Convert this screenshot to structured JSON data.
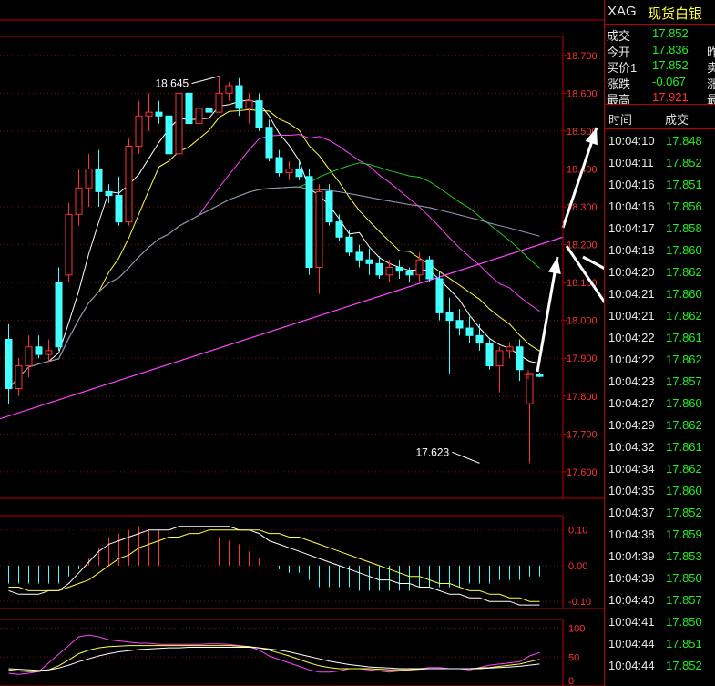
{
  "symbol": {
    "code": "XAG",
    "name": "现货白银",
    "code_color": "#e8e8e8",
    "name_color": "#ffff33"
  },
  "quote": [
    {
      "label": "成交",
      "value": "17.852",
      "color": "#22ee22",
      "extra": ""
    },
    {
      "label": "今开",
      "value": "17.836",
      "color": "#22ee22",
      "extra": "昨"
    },
    {
      "label": "买价1",
      "value": "17.852",
      "color": "#22ee22",
      "extra": "卖"
    },
    {
      "label": "涨跌",
      "value": "-0.067",
      "color": "#22ee22",
      "extra": "涨"
    },
    {
      "label": "最高",
      "value": "17.921",
      "color": "#ff3333",
      "extra": "最"
    }
  ],
  "ticks_header": {
    "time": "时间",
    "price": "成交"
  },
  "ticks": [
    {
      "time": "10:04:10",
      "price": "17.848"
    },
    {
      "time": "10:04:11",
      "price": "17.852"
    },
    {
      "time": "10:04:16",
      "price": "17.851"
    },
    {
      "time": "10:04:16",
      "price": "17.856"
    },
    {
      "time": "10:04:17",
      "price": "17.858"
    },
    {
      "time": "10:04:18",
      "price": "17.860"
    },
    {
      "time": "10:04:20",
      "price": "17.862"
    },
    {
      "time": "10:04:21",
      "price": "17.860"
    },
    {
      "time": "10:04:21",
      "price": "17.862"
    },
    {
      "time": "10:04:22",
      "price": "17.861"
    },
    {
      "time": "10:04:22",
      "price": "17.862"
    },
    {
      "time": "10:04:23",
      "price": "17.857"
    },
    {
      "time": "10:04:27",
      "price": "17.860"
    },
    {
      "time": "10:04:29",
      "price": "17.862"
    },
    {
      "time": "10:04:32",
      "price": "17.861"
    },
    {
      "time": "10:04:34",
      "price": "17.862"
    },
    {
      "time": "10:04:35",
      "price": "17.860"
    },
    {
      "time": "10:04:37",
      "price": "17.852"
    },
    {
      "time": "10:04:38",
      "price": "17.859"
    },
    {
      "time": "10:04:39",
      "price": "17.853"
    },
    {
      "time": "10:04:39",
      "price": "17.850"
    },
    {
      "time": "10:04:40",
      "price": "17.857"
    },
    {
      "time": "10:04:41",
      "price": "17.850"
    },
    {
      "time": "10:04:44",
      "price": "17.851"
    },
    {
      "time": "10:04:44",
      "price": "17.852"
    }
  ],
  "chart_data": [
    {
      "type": "candlestick",
      "title": "",
      "ylim": [
        17.53,
        18.75
      ],
      "yticks": [
        "18.700",
        "18.600",
        "18.500",
        "18.400",
        "18.300",
        "18.200",
        "18.100",
        "18.000",
        "17.900",
        "17.800",
        "17.700",
        "17.600"
      ],
      "annotations": [
        {
          "text": "18.645",
          "index": 21,
          "value": 18.645
        },
        {
          "text": "17.623",
          "index": 47,
          "value": 17.623
        }
      ],
      "ohlc": [
        [
          17.95,
          17.99,
          17.78,
          17.82
        ],
        [
          17.82,
          17.9,
          17.8,
          17.88
        ],
        [
          17.88,
          17.96,
          17.85,
          17.93
        ],
        [
          17.93,
          17.96,
          17.9,
          17.91
        ],
        [
          17.91,
          17.95,
          17.89,
          17.92
        ],
        [
          18.1,
          18.14,
          17.92,
          17.93
        ],
        [
          18.12,
          18.31,
          18.1,
          18.28
        ],
        [
          18.28,
          18.4,
          18.25,
          18.35
        ],
        [
          18.35,
          18.44,
          18.3,
          18.4
        ],
        [
          18.4,
          18.45,
          18.3,
          18.34
        ],
        [
          18.34,
          18.36,
          18.31,
          18.33
        ],
        [
          18.33,
          18.38,
          18.25,
          18.26
        ],
        [
          18.26,
          18.48,
          18.25,
          18.46
        ],
        [
          18.46,
          18.58,
          18.44,
          18.54
        ],
        [
          18.54,
          18.6,
          18.5,
          18.55
        ],
        [
          18.55,
          18.58,
          18.52,
          18.54
        ],
        [
          18.54,
          18.6,
          18.42,
          18.44
        ],
        [
          18.44,
          18.62,
          18.43,
          18.6
        ],
        [
          18.6,
          18.62,
          18.5,
          18.52
        ],
        [
          18.52,
          18.58,
          18.48,
          18.56
        ],
        [
          18.56,
          18.58,
          18.54,
          18.55
        ],
        [
          18.55,
          18.645,
          18.55,
          18.6
        ],
        [
          18.6,
          18.63,
          18.58,
          18.62
        ],
        [
          18.62,
          18.64,
          18.54,
          18.56
        ],
        [
          18.56,
          18.6,
          18.52,
          18.58
        ],
        [
          18.58,
          18.6,
          18.5,
          18.51
        ],
        [
          18.51,
          18.53,
          18.42,
          18.43
        ],
        [
          18.43,
          18.45,
          18.38,
          18.39
        ],
        [
          18.39,
          18.42,
          18.37,
          18.4
        ],
        [
          18.4,
          18.42,
          18.37,
          18.38
        ],
        [
          18.38,
          18.4,
          18.12,
          18.14
        ],
        [
          18.14,
          18.36,
          18.07,
          18.34
        ],
        [
          18.34,
          18.36,
          18.25,
          18.26
        ],
        [
          18.26,
          18.28,
          18.21,
          18.22
        ],
        [
          18.22,
          18.24,
          18.17,
          18.18
        ],
        [
          18.18,
          18.2,
          18.14,
          18.16
        ],
        [
          18.16,
          18.19,
          18.12,
          18.15
        ],
        [
          18.15,
          18.17,
          18.11,
          18.12
        ],
        [
          18.12,
          18.16,
          18.1,
          18.14
        ],
        [
          18.14,
          18.16,
          18.11,
          18.13
        ],
        [
          18.13,
          18.14,
          18.1,
          18.12
        ],
        [
          18.12,
          18.18,
          18.1,
          18.16
        ],
        [
          18.16,
          18.17,
          18.1,
          18.11
        ],
        [
          18.11,
          18.13,
          18.0,
          18.02
        ],
        [
          18.02,
          18.06,
          17.86,
          18.0
        ],
        [
          18.0,
          18.03,
          17.96,
          17.98
        ],
        [
          17.98,
          18.01,
          17.94,
          17.96
        ],
        [
          17.96,
          17.99,
          17.92,
          17.94
        ],
        [
          17.94,
          17.95,
          17.87,
          17.88
        ],
        [
          17.88,
          17.93,
          17.81,
          17.92
        ],
        [
          17.92,
          17.94,
          17.9,
          17.93
        ],
        [
          17.93,
          17.95,
          17.84,
          17.87
        ],
        [
          17.78,
          17.86,
          17.623,
          17.86
        ],
        [
          17.857,
          17.862,
          17.85,
          17.852
        ]
      ],
      "annotated_arrows": true
    },
    {
      "type": "bar",
      "title": "",
      "ylim": [
        -0.12,
        0.14
      ],
      "yticks": [
        "0.10",
        "0.00",
        "-0.10"
      ],
      "histogram": [
        -0.05,
        -0.05,
        -0.05,
        -0.05,
        -0.05,
        -0.05,
        -0.03,
        -0.01,
        0.02,
        0.05,
        0.08,
        0.09,
        0.1,
        0.11,
        0.1,
        0.1,
        0.1,
        0.1,
        0.1,
        0.09,
        0.09,
        0.08,
        0.07,
        0.06,
        0.04,
        0.02,
        0.0,
        -0.01,
        -0.02,
        -0.02,
        -0.04,
        -0.06,
        -0.06,
        -0.06,
        -0.06,
        -0.07,
        -0.07,
        -0.07,
        -0.07,
        -0.07,
        -0.07,
        -0.06,
        -0.06,
        -0.06,
        -0.06,
        -0.06,
        -0.05,
        -0.05,
        -0.05,
        -0.04,
        -0.04,
        -0.04,
        -0.03,
        -0.03
      ],
      "dif": [
        -0.07,
        -0.08,
        -0.08,
        -0.08,
        -0.07,
        -0.07,
        -0.05,
        -0.02,
        0.01,
        0.04,
        0.06,
        0.07,
        0.08,
        0.09,
        0.1,
        0.1,
        0.1,
        0.11,
        0.11,
        0.11,
        0.11,
        0.11,
        0.11,
        0.1,
        0.1,
        0.09,
        0.07,
        0.06,
        0.05,
        0.04,
        0.03,
        0.02,
        0.01,
        0.0,
        -0.01,
        -0.02,
        -0.03,
        -0.04,
        -0.04,
        -0.05,
        -0.05,
        -0.06,
        -0.06,
        -0.07,
        -0.08,
        -0.08,
        -0.09,
        -0.09,
        -0.1,
        -0.1,
        -0.1,
        -0.11,
        -0.11,
        -0.11
      ],
      "dea": [
        -0.06,
        -0.06,
        -0.07,
        -0.07,
        -0.07,
        -0.07,
        -0.06,
        -0.05,
        -0.04,
        -0.02,
        0.0,
        0.02,
        0.03,
        0.05,
        0.06,
        0.07,
        0.08,
        0.08,
        0.09,
        0.09,
        0.1,
        0.1,
        0.1,
        0.1,
        0.1,
        0.1,
        0.09,
        0.09,
        0.08,
        0.08,
        0.07,
        0.06,
        0.05,
        0.04,
        0.03,
        0.02,
        0.01,
        0.0,
        -0.01,
        -0.02,
        -0.03,
        -0.03,
        -0.04,
        -0.05,
        -0.05,
        -0.06,
        -0.07,
        -0.07,
        -0.08,
        -0.08,
        -0.09,
        -0.09,
        -0.1,
        -0.1
      ]
    },
    {
      "type": "line",
      "title": "",
      "ylim": [
        0,
        115
      ],
      "yticks": [
        "100",
        "50",
        "0"
      ],
      "series": [
        {
          "color": "#ff44ff",
          "values": [
            22,
            20,
            22,
            25,
            40,
            55,
            70,
            85,
            88,
            85,
            80,
            78,
            76,
            74,
            74,
            72,
            72,
            72,
            72,
            72,
            73,
            73,
            72,
            70,
            68,
            62,
            52,
            46,
            40,
            34,
            28,
            24,
            24,
            26,
            30,
            30,
            28,
            26,
            24,
            26,
            28,
            30,
            32,
            32,
            30,
            30,
            28,
            32,
            36,
            38,
            40,
            42,
            52,
            58
          ]
        },
        {
          "color": "#ffff44",
          "values": [
            28,
            26,
            25,
            25,
            28,
            35,
            45,
            56,
            62,
            66,
            68,
            69,
            70,
            70,
            70,
            70,
            70,
            70,
            70,
            70,
            70,
            70,
            70,
            69,
            68,
            66,
            62,
            57,
            52,
            46,
            40,
            35,
            32,
            30,
            30,
            30,
            30,
            29,
            28,
            28,
            28,
            29,
            30,
            30,
            30,
            30,
            30,
            31,
            32,
            34,
            36,
            38,
            42,
            46
          ]
        },
        {
          "color": "#ffffff",
          "values": [
            30,
            29,
            28,
            27,
            28,
            31,
            36,
            42,
            47,
            52,
            56,
            59,
            61,
            63,
            64,
            65,
            66,
            66,
            67,
            67,
            67,
            67,
            67,
            67,
            67,
            66,
            64,
            62,
            59,
            55,
            51,
            47,
            43,
            40,
            37,
            35,
            33,
            32,
            31,
            30,
            30,
            30,
            30,
            30,
            30,
            30,
            30,
            30,
            31,
            32,
            33,
            34,
            36,
            38
          ]
        }
      ]
    }
  ]
}
